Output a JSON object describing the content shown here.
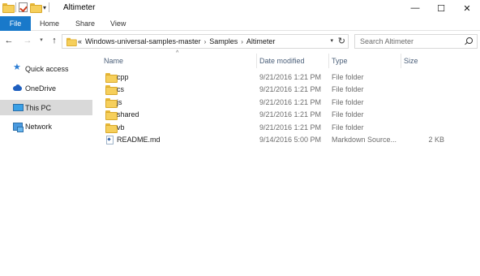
{
  "window": {
    "title": "Altimeter",
    "minimize": "—",
    "maximize": "☐",
    "close": "✕"
  },
  "ribbon": {
    "tabs": [
      "File",
      "Home",
      "Share",
      "View"
    ]
  },
  "address": {
    "prefix": "«",
    "crumbs": [
      "Windows-universal-samples-master",
      "Samples",
      "Altimeter"
    ],
    "separator": "›"
  },
  "search": {
    "placeholder": "Search Altimeter"
  },
  "sidebar": {
    "items": [
      {
        "label": "Quick access",
        "icon": "star-icon"
      },
      {
        "label": "OneDrive",
        "icon": "cloud-icon"
      },
      {
        "label": "This PC",
        "icon": "computer-icon",
        "selected": true
      },
      {
        "label": "Network",
        "icon": "network-icon"
      }
    ]
  },
  "columns": {
    "name": "Name",
    "date": "Date modified",
    "type": "Type",
    "size": "Size"
  },
  "files": [
    {
      "name": "cpp",
      "date": "9/21/2016 1:21 PM",
      "type": "File folder",
      "size": "",
      "icon": "folder-icon"
    },
    {
      "name": "cs",
      "date": "9/21/2016 1:21 PM",
      "type": "File folder",
      "size": "",
      "icon": "folder-icon"
    },
    {
      "name": "js",
      "date": "9/21/2016 1:21 PM",
      "type": "File folder",
      "size": "",
      "icon": "folder-icon"
    },
    {
      "name": "shared",
      "date": "9/21/2016 1:21 PM",
      "type": "File folder",
      "size": "",
      "icon": "folder-icon"
    },
    {
      "name": "vb",
      "date": "9/21/2016 1:21 PM",
      "type": "File folder",
      "size": "",
      "icon": "folder-icon"
    },
    {
      "name": "README.md",
      "date": "9/14/2016 5:00 PM",
      "type": "Markdown Source...",
      "size": "2 KB",
      "icon": "markdown-file-icon"
    }
  ],
  "colors": {
    "accent": "#1979ca",
    "selected_bg": "#d9d9d9",
    "header_text": "#4c607a",
    "folder": "#f6cf5b"
  }
}
